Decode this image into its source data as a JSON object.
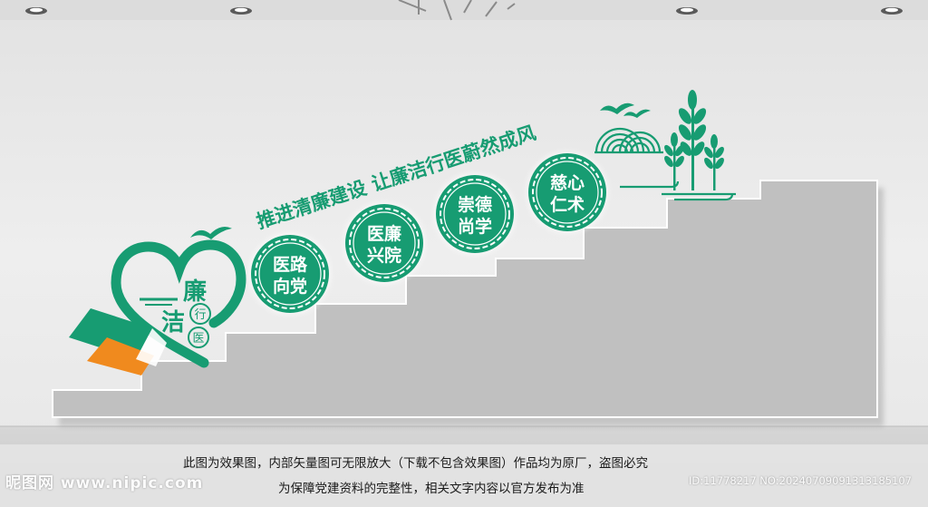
{
  "artwork": {
    "slogan": "推进清廉建设 让廉洁行医蔚然成风",
    "logo_chars": [
      "廉",
      "洁",
      "行",
      "医"
    ],
    "medallions": [
      {
        "line1": "医路",
        "line2": "向党"
      },
      {
        "line1": "医廉",
        "line2": "兴院"
      },
      {
        "line1": "崇德",
        "line2": "尚学"
      },
      {
        "line1": "慈心",
        "line2": "仁术"
      }
    ],
    "colors": {
      "green": "#179c72",
      "orange": "#f08a1e",
      "stair": "#bfbfbf",
      "wall": "#ececec"
    }
  },
  "caption": {
    "line1": "此图为效果图，内部矢量图可无限放大（下载不包含效果图）作品均为原厂，盗图必究",
    "line2": "为保障党建资料的完整性，相关文字内容以官方发布为准"
  },
  "watermark": {
    "brand": "昵图网 www.nipic.com",
    "id_text": "ID:11778217 NO:20240709091313185107"
  }
}
